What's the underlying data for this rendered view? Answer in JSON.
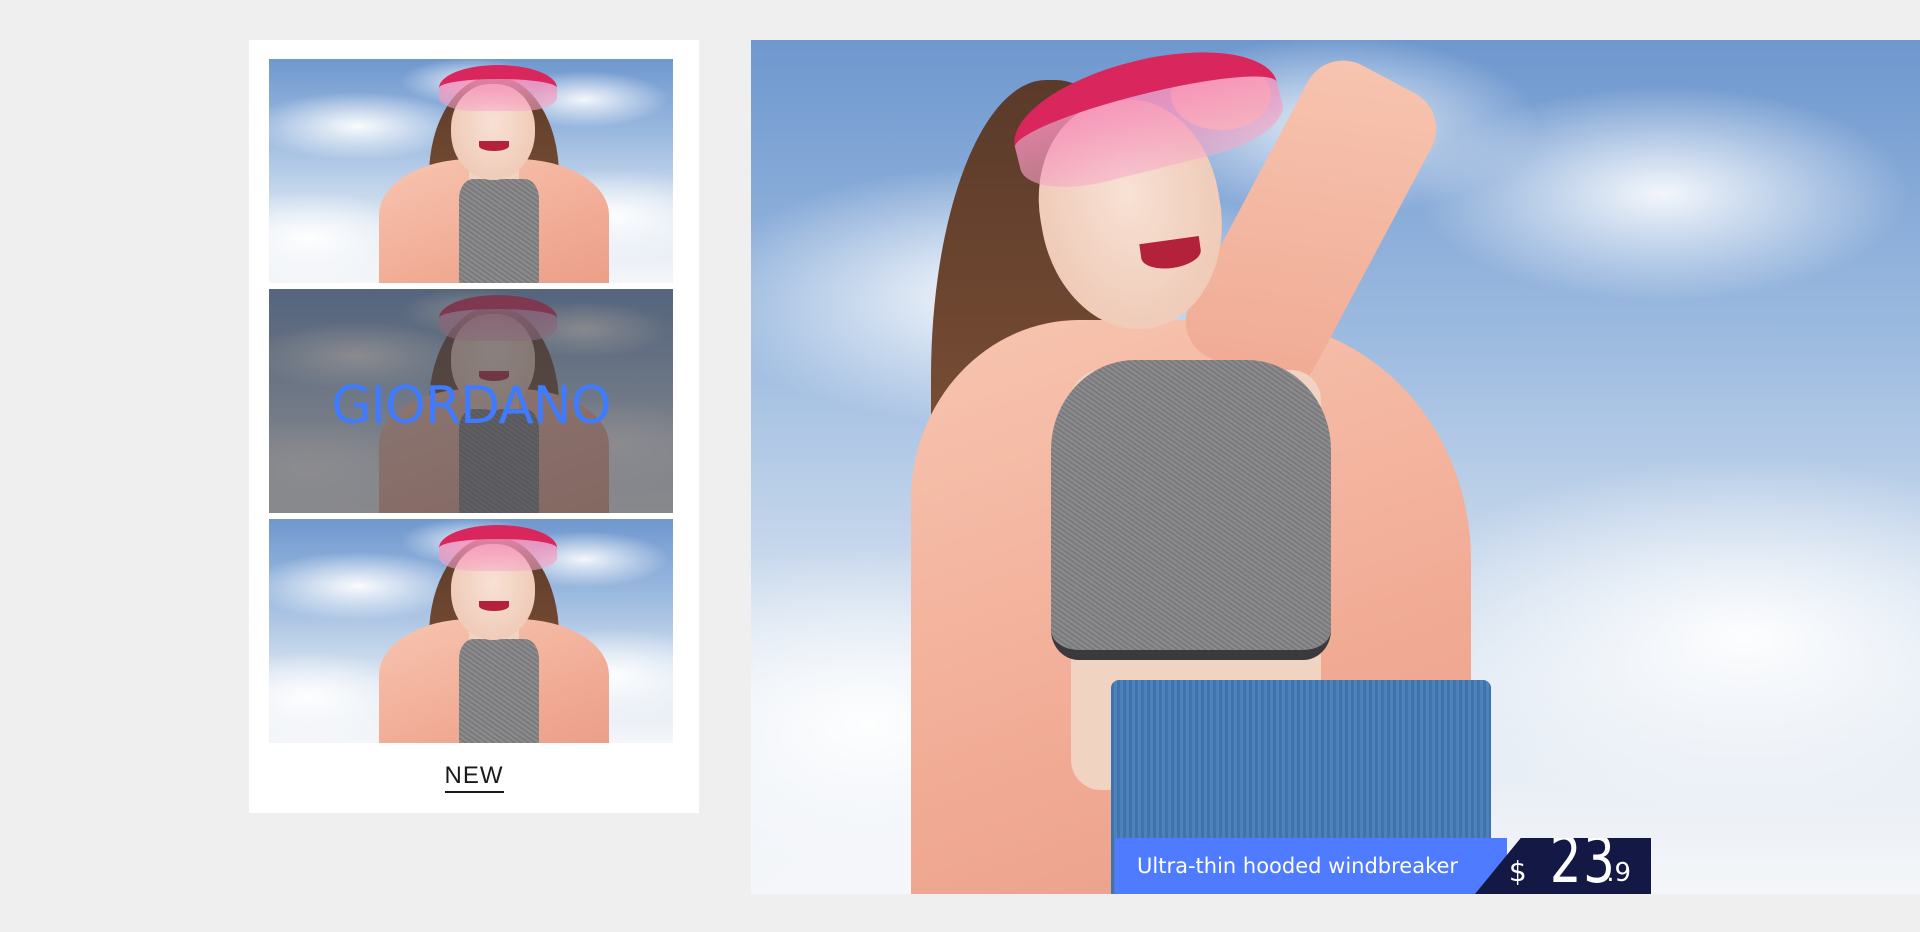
{
  "card": {
    "brand_overlay": "GIORDANO",
    "new_label": "NEW"
  },
  "hero": {
    "tagline": "Ultra-thin hooded windbreaker",
    "price": {
      "currency": "$",
      "integer": "23",
      "decimal": ".9"
    }
  },
  "colors": {
    "page_background": "#efefef",
    "brand_blue": "#3f7bff",
    "tagline_bar": "#4e7bff",
    "price_bg": "#131844"
  }
}
